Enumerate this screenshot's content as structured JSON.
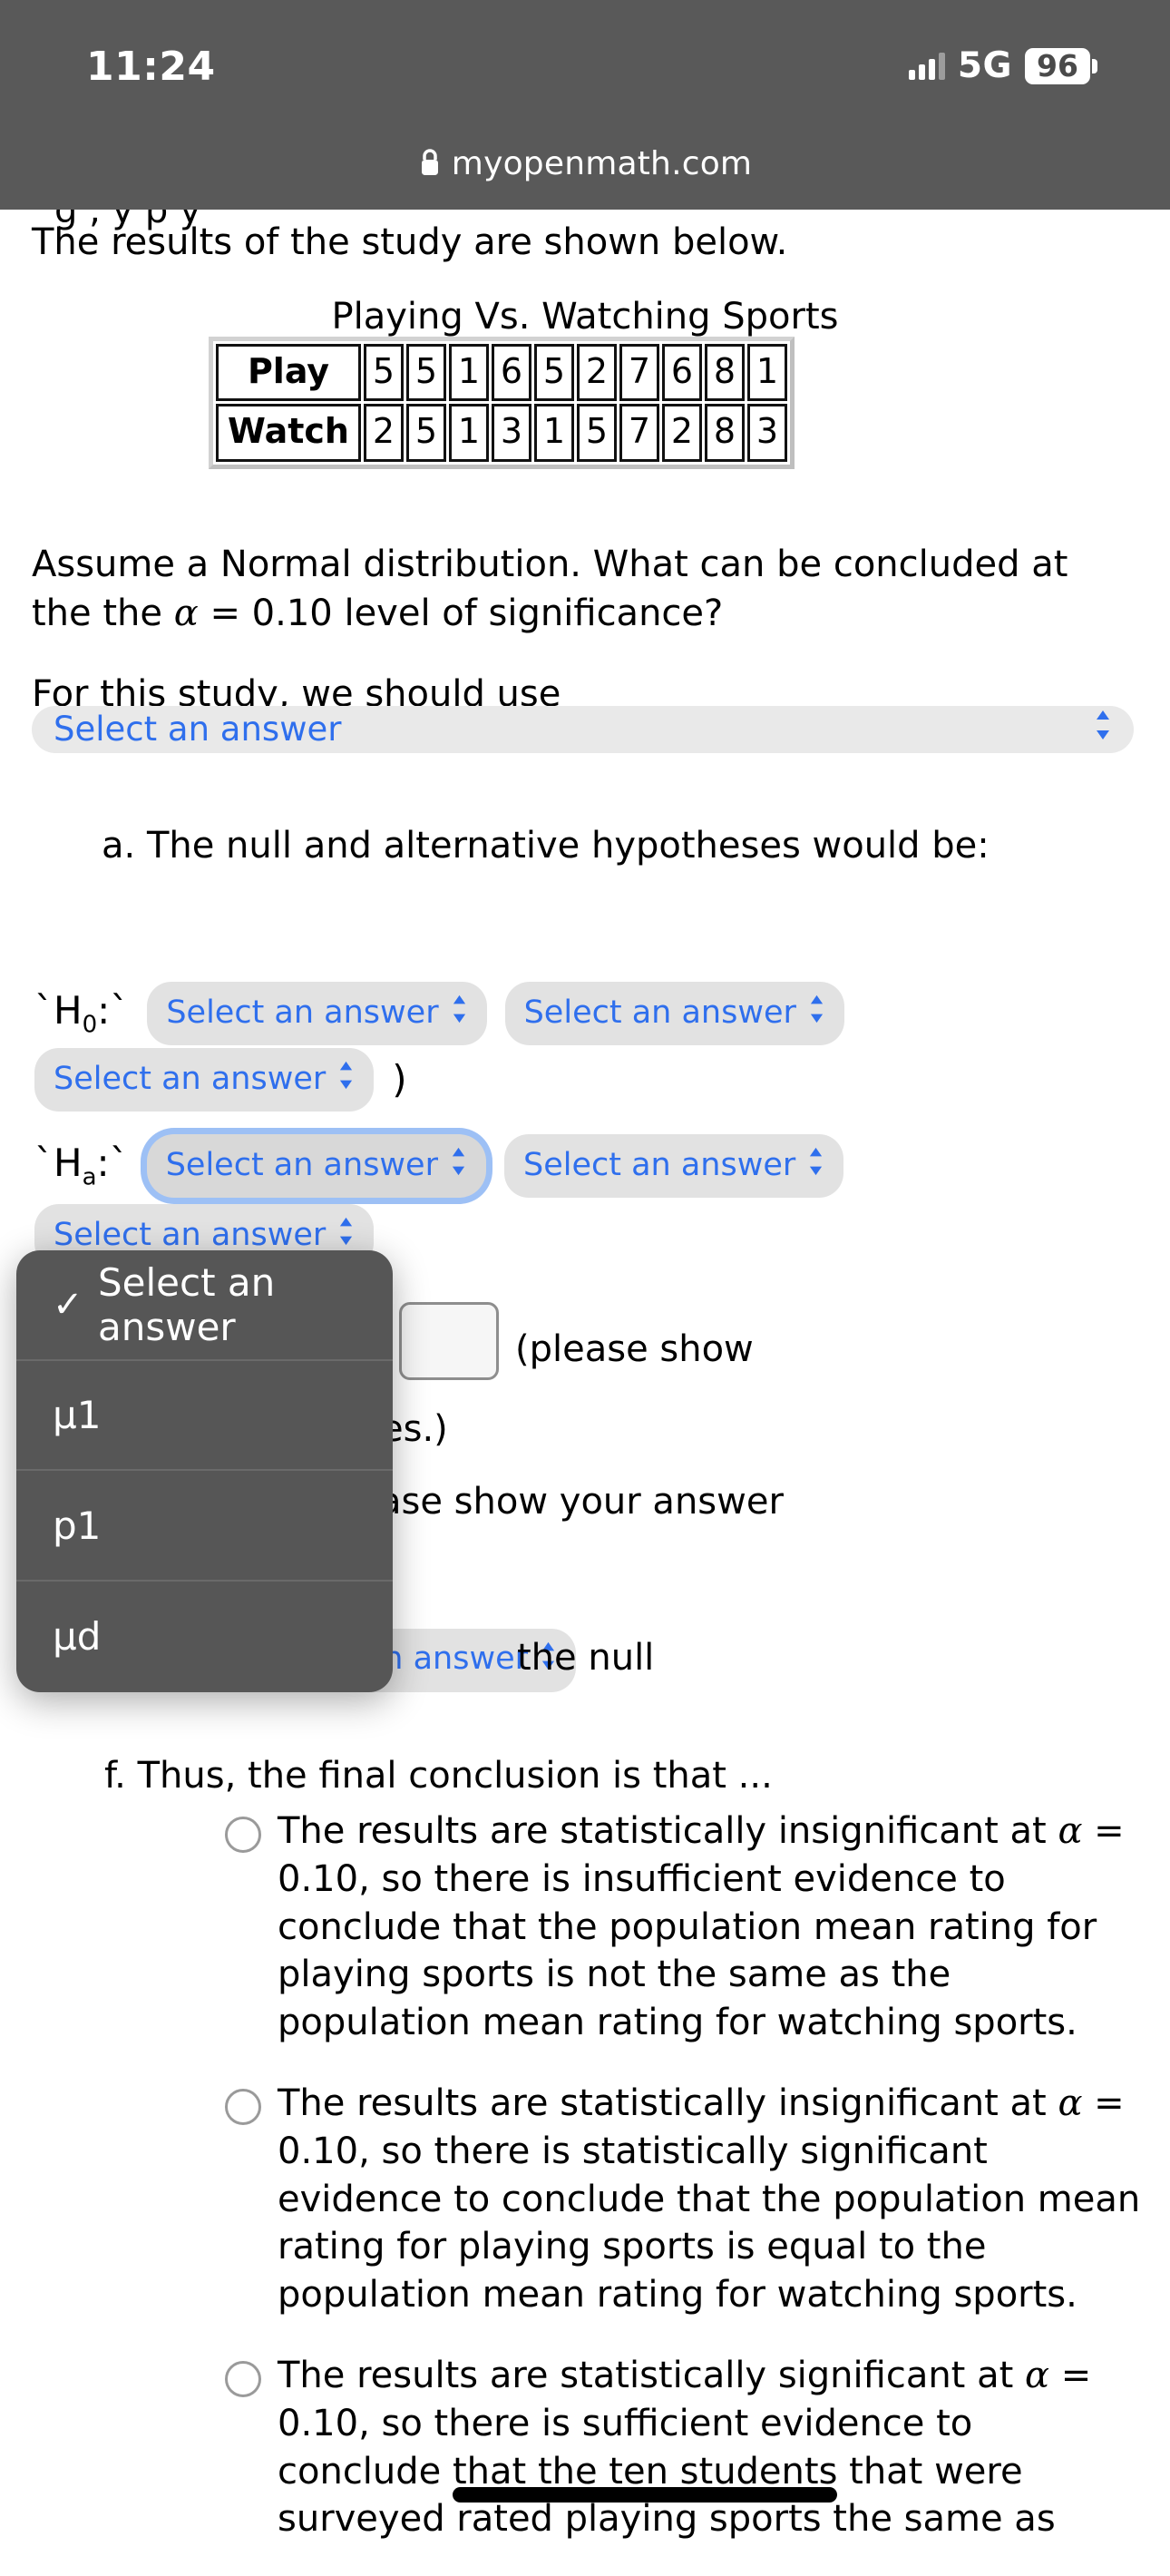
{
  "status_bar": {
    "time": "11:24",
    "network": "5G",
    "battery": "96",
    "signal_icon": "cellular-signal-icon",
    "battery_icon": "battery-icon"
  },
  "browser": {
    "lock_icon": "lock-icon",
    "url": "myopenmath.com"
  },
  "page": {
    "cut_text": "g ,  y   p     y",
    "results_intro": "The results of the study are shown below.",
    "table": {
      "title": "Playing Vs. Watching Sports",
      "rows": [
        {
          "header": "Play",
          "values": [
            "5",
            "5",
            "1",
            "6",
            "5",
            "2",
            "7",
            "6",
            "8",
            "1"
          ]
        },
        {
          "header": "Watch",
          "values": [
            "2",
            "5",
            "1",
            "3",
            "1",
            "5",
            "7",
            "2",
            "8",
            "3"
          ]
        }
      ]
    },
    "assume_line_1": "Assume a Normal distribution.  What can be concluded at",
    "assume_line_2_pre": "the the ",
    "assume_alpha": "α",
    "assume_line_2_post": " = 0.10 level of significance?",
    "study_prompt": "For this study, we should use",
    "study_select": {
      "label": "Select an answer",
      "chevron_icon": "chevron-updown-icon"
    },
    "item_a": "a.  The null and alternative hypotheses would be:",
    "hypotheses": {
      "h0_label_pre": "`H",
      "h0_sub": "0",
      "h0_label_post": ":`",
      "ha_label_pre": "`H",
      "ha_sub": "a",
      "ha_label_post": ":`",
      "select_label": "Select an answer",
      "chevron_icon": "chevron-updown-icon",
      "close_paren": ")"
    },
    "obscured": {
      "please_show": "(please show",
      "es_paren": "es.)",
      "ase_show": "ase show your answer",
      "select_label": "t an answer",
      "the_null": "the null"
    },
    "item_f": "f.  Thus, the final conclusion is that ...",
    "options": [
      {
        "text_before": "The results are statistically insignificant at ",
        "alpha": "α",
        "text_after": " = 0.10, so there is insufficient evidence to conclude that the population mean rating for playing sports is not the same as the population mean rating for watching sports.",
        "selected": false
      },
      {
        "text_before": "The results are statistically insignificant at ",
        "alpha": "α",
        "text_after": " = 0.10, so there is statistically significant evidence to conclude that the population mean rating for playing sports is equal to the population mean rating for watching sports.",
        "selected": false
      },
      {
        "text_before": "The results are statistically significant at ",
        "alpha": "α",
        "text_after_1": " = 0.10, so there is sufficient evidence to conclude ",
        "highlighted": "that the ten students",
        "text_after_2": " that were surveyed rated playing sports the same as",
        "selected": false
      }
    ]
  },
  "picker": {
    "check_icon": "checkmark-icon",
    "items": [
      {
        "label": "Select an answer",
        "selected": true
      },
      {
        "label": "μ1",
        "selected": false
      },
      {
        "label": "p1",
        "selected": false
      },
      {
        "label": "μd",
        "selected": false
      }
    ]
  },
  "colors": {
    "link_blue": "#2f6fed",
    "pill_gray": "#e2e2e2",
    "chrome_gray": "#595959",
    "picker_gray": "#565656",
    "focus_ring": "#9dc0f5"
  }
}
